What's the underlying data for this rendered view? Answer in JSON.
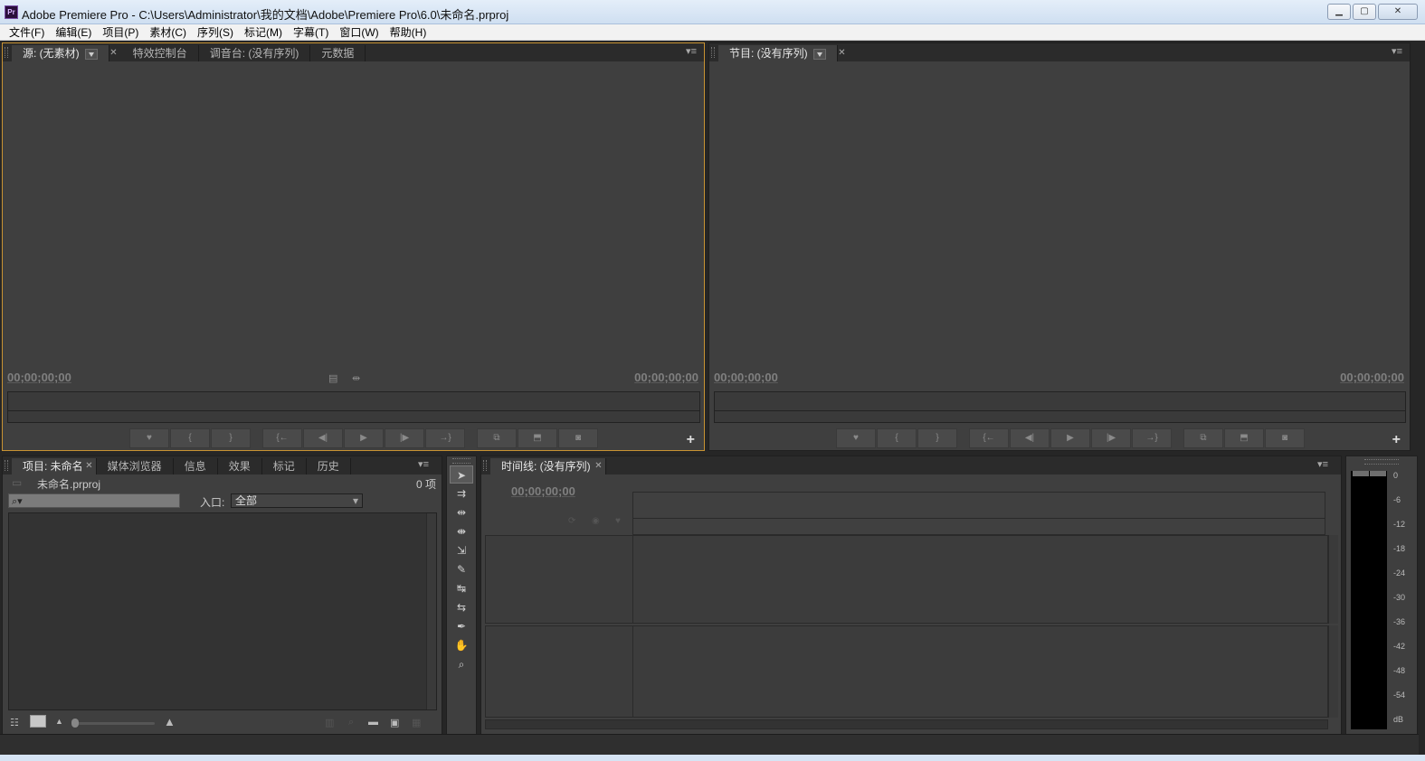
{
  "window": {
    "app_icon": "Pr",
    "title": "Adobe Premiere Pro - C:\\Users\\Administrator\\我的文档\\Adobe\\Premiere Pro\\6.0\\未命名.prproj",
    "buttons": {
      "minimize": "▁",
      "maximize": "▢",
      "close": "✕"
    }
  },
  "menu": [
    "文件(F)",
    "编辑(E)",
    "项目(P)",
    "素材(C)",
    "序列(S)",
    "标记(M)",
    "字幕(T)",
    "窗口(W)",
    "帮助(H)"
  ],
  "source_panel": {
    "tabs": [
      "源: (无素材)",
      "特效控制台",
      "调音台: (没有序列)",
      "元数据"
    ],
    "timecode_in": "00;00;00;00",
    "timecode_out": "00;00;00;00",
    "accent_color": "#c89232"
  },
  "program_panel": {
    "tabs": [
      "节目: (没有序列)"
    ],
    "timecode_in": "00;00;00;00",
    "timecode_out": "00;00;00;00"
  },
  "controls": {
    "icons": [
      "marker-icon",
      "mark-in-icon",
      "mark-out-icon",
      "go-to-in-icon",
      "step-back-icon",
      "play-icon",
      "step-forward-icon",
      "go-to-out-icon",
      "insert-icon",
      "overwrite-icon",
      "export-frame-icon"
    ]
  },
  "project_panel": {
    "tabs": [
      "项目: 未命名",
      "媒体浏览器",
      "信息",
      "效果",
      "标记",
      "历史"
    ],
    "file_name": "未命名.prproj",
    "item_count": "0 项",
    "search_placeholder": "",
    "entry_label": "入口:",
    "entry_value": "全部"
  },
  "timeline_panel": {
    "tabs": [
      "时间线: (没有序列)"
    ],
    "timecode": "00;00;00;00"
  },
  "tools": [
    "selection-tool",
    "track-select-tool",
    "ripple-edit-tool",
    "rolling-edit-tool",
    "rate-stretch-tool",
    "razor-tool",
    "slip-tool",
    "slide-tool",
    "pen-tool",
    "hand-tool",
    "zoom-tool"
  ],
  "audio_meter": {
    "labels": [
      "0",
      "-6",
      "-12",
      "-18",
      "-24",
      "-30",
      "-36",
      "-42",
      "-48",
      "-54",
      "dB"
    ]
  }
}
